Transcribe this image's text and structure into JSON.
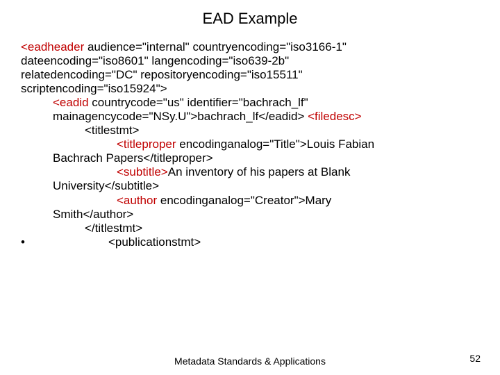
{
  "title": "EAD Example",
  "line1a": "<eadheader",
  "line1b": " audience=\"internal\" countryencoding=\"iso3166-1\"",
  "line2": "dateencoding=\"iso8601\" langencoding=\"iso639-2b\"",
  "line3": "relatedencoding=\"DC\" repositoryencoding=\"iso15511\"",
  "line4": "scriptencoding=\"iso15924\">",
  "line5a": "<eadid",
  "line5b": " countrycode=\"us\" identifier=\"bachrach_lf\"",
  "line6a": "mainagencycode=\"NSy.U\">bachrach_lf</eadid>   ",
  "line6b": "<filedesc>",
  "line7": "<titlestmt>",
  "line8a": "<titleproper",
  "line8b": " encodinganalog=\"Title\">Louis Fabian",
  "line9": "Bachrach Papers</titleproper>",
  "line10a": "<subtitle>",
  "line10b": "An inventory of his papers at Blank",
  "line11": "University</subtitle>",
  "line12a": "<author",
  "line12b": " encodinganalog=\"Creator\">Mary",
  "line13": "Smith</author>",
  "line14": "</titlestmt>",
  "bullet": "•",
  "line15": "<publicationstmt>",
  "footer_center": "Metadata Standards & Applications",
  "footer_right": "52"
}
